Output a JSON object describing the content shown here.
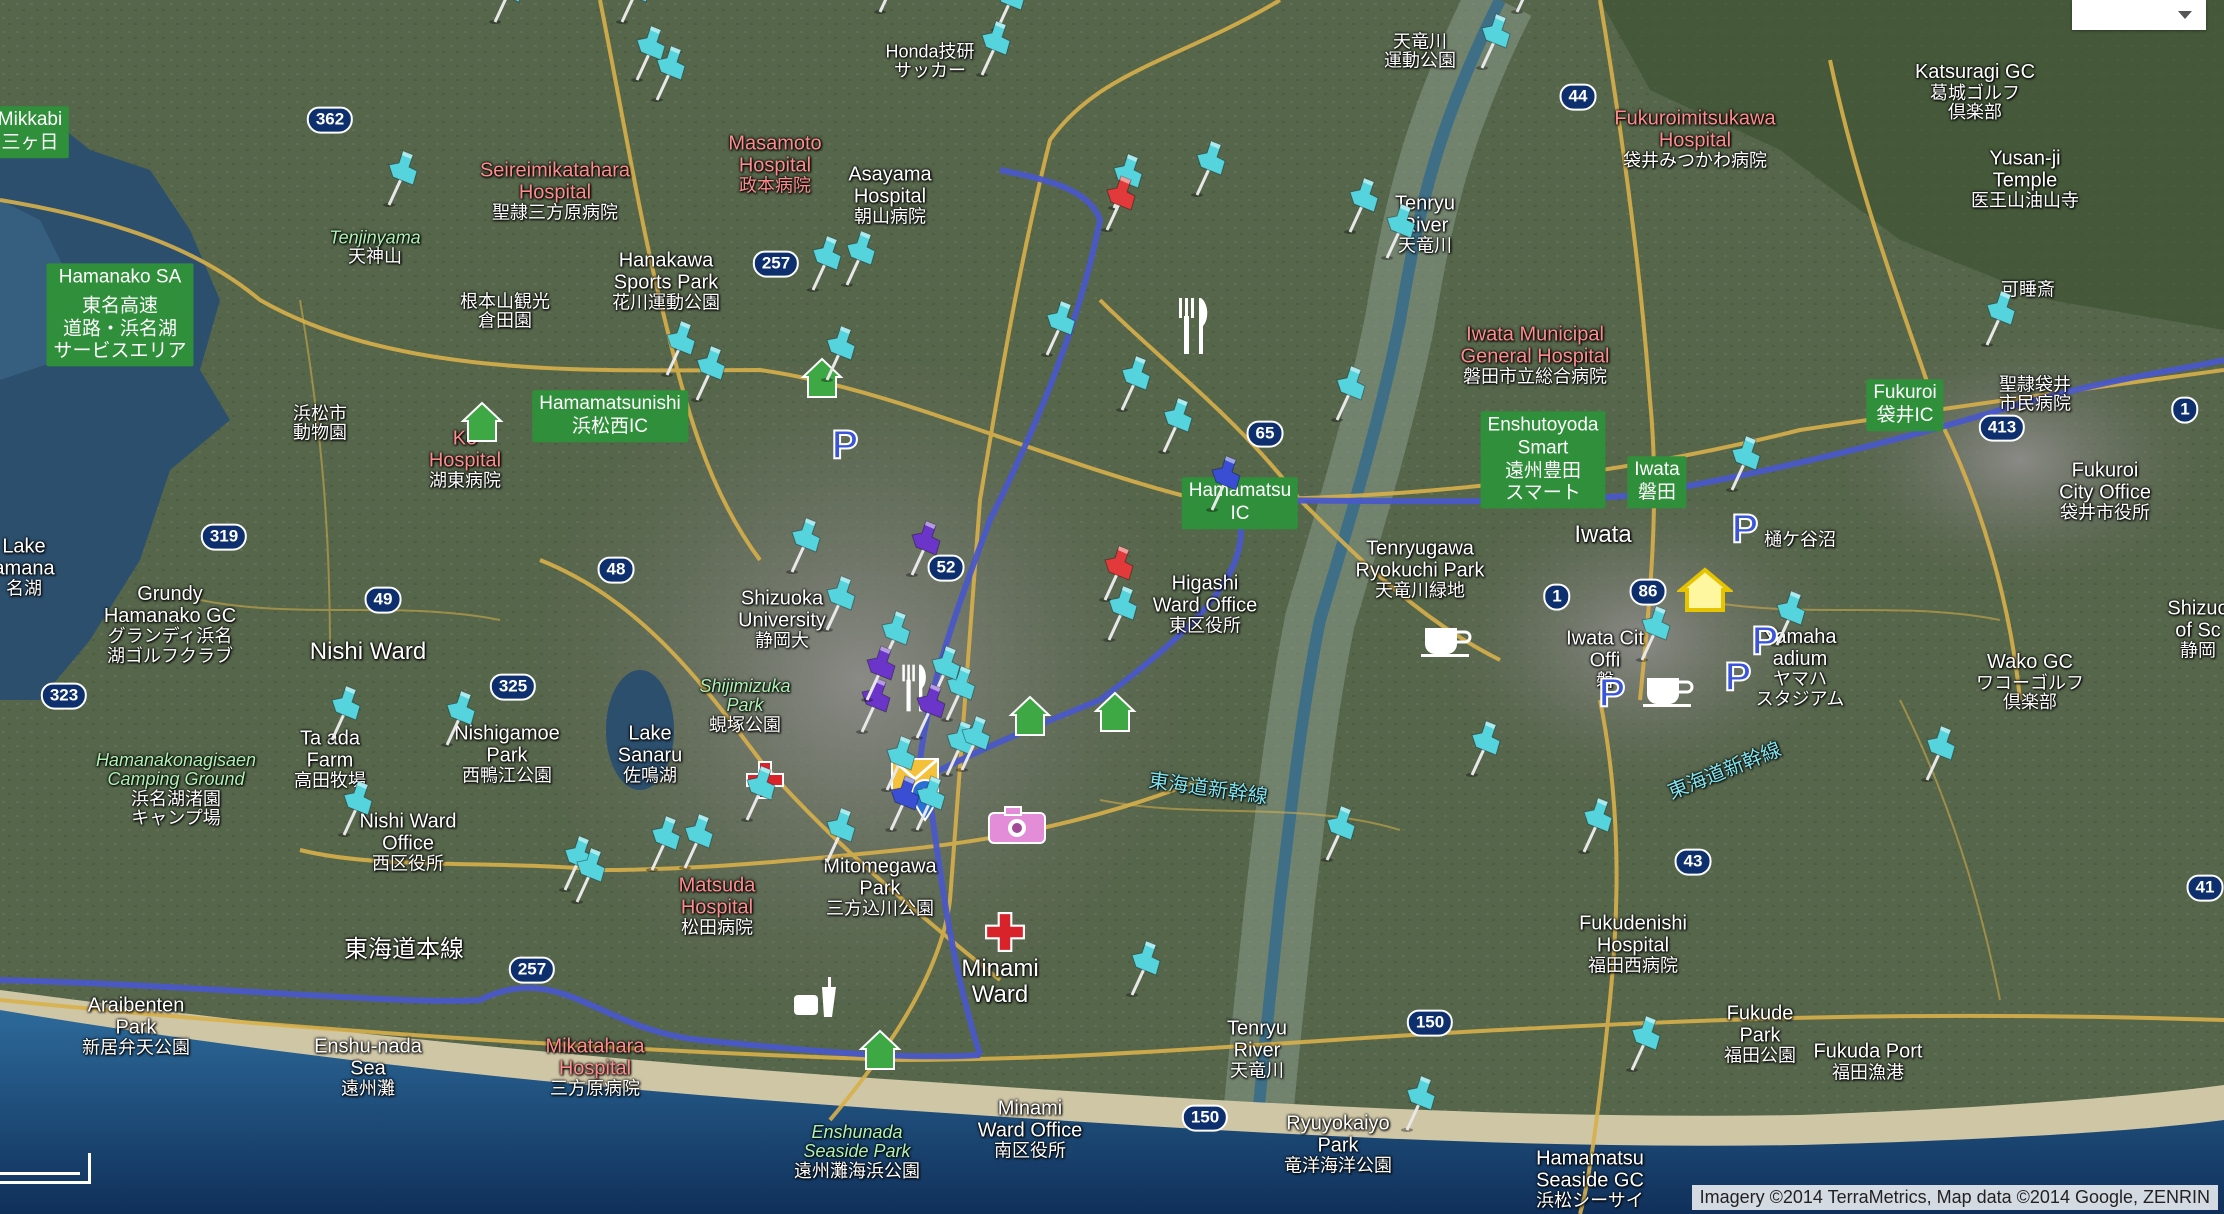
{
  "colors": {
    "highway": "#4a58c8",
    "road": "#d8b04a",
    "route_shield": "#0d2f6e",
    "hospital": "#ff8c8c",
    "park_text": "#aef2b4",
    "pin": "#56d4dd",
    "pin_red": "#e23a3a",
    "pin_purple": "#6a35c8",
    "pin_blue": "#3a4ed4",
    "label_box": "#2f8f3a",
    "sea": "#1f4e86"
  },
  "map_type_control": {
    "icon": "chevron-down-icon"
  },
  "attribution": "Imagery ©2014 TerraMetrics, Map data ©2014 Google, ZENRIN",
  "labels": {
    "tenryugawa": {
      "en": "",
      "jp": "天竜川"
    },
    "tenryugawa2": {
      "jp": "運動公園"
    },
    "honda": {
      "jp": "Honda技研"
    },
    "honda2": {
      "jp": "サッカー"
    },
    "katsuragi": {
      "en": "Katsuragi GC",
      "jp": "葛城ゴルフ"
    },
    "katsuragi2": {
      "jp": "倶楽部"
    },
    "mikkabi": {
      "en": "Mikkabi",
      "jp": "三ヶ日"
    },
    "masamoto": {
      "en": "Masamoto",
      "en2": "Hospital",
      "jp": "政本病院"
    },
    "asayama": {
      "en": "Asayama",
      "en2": "Hospital",
      "jp": "朝山病院"
    },
    "fukuroimitsukawa": {
      "en": "Fukuroimitsukawa",
      "en2": "Hospital",
      "jp": "袋井みつかわ病院"
    },
    "yusanji": {
      "en": "Yusan-ji",
      "en2": "Temple",
      "jp": "医王山油山寺"
    },
    "kashoin": {
      "jp": "可睡斎"
    },
    "seireimikatahara": {
      "en": "Seireimikatahara",
      "en2": "Hospital",
      "jp": "聖隷三方原病院"
    },
    "tenryuriver": {
      "en": "Tenryu",
      "en2": "River",
      "jp": "天竜川"
    },
    "tenjinyama": {
      "en": "Tenjinyama",
      "jp": "天神山"
    },
    "hanakawa": {
      "en": "Hanakawa",
      "en2": "Sports Park",
      "jp": "花川運動公園"
    },
    "nemotoyama": {
      "jp": "根本山観光",
      "jp2": "倉田園"
    },
    "hamanakosa": {
      "en": "Hamanako SA",
      "jp": "東名高速",
      "jp2": "道路・浜名湖",
      "jp3": "サービスエリア"
    },
    "iwatagen": {
      "en": "Iwata Municipal",
      "en2": "General Hospital",
      "jp": "磐田市立総合病院"
    },
    "hamamatsuzoo": {
      "jp": "浜松市",
      "jp2": "動物園"
    },
    "hamamatsunishi": {
      "en": "Hamamatsunishi",
      "jp": "浜松西IC"
    },
    "kohospital": {
      "en": "Ko",
      "en2": "Hospital",
      "jp": "湖東病院"
    },
    "fukuroi_ic": {
      "en": "Fukuroi",
      "jp": "袋井IC"
    },
    "seireifukuroi": {
      "jp": "聖隷袋井",
      "jp2": "市民病院"
    },
    "enshutoyoda": {
      "en": "Enshutoyoda",
      "en2": "Smart",
      "jp": "遠州豊田",
      "jp2": "スマート"
    },
    "iwata_ic": {
      "en": "Iwata",
      "jp": "磐田"
    },
    "hamamatsu_ic": {
      "en": "Hamamatsu",
      "jp": "IC"
    },
    "fukuroi_city": {
      "en": "Fukuroi",
      "en2": "City Office",
      "jp": "袋井市役所"
    },
    "hichigakubo": {
      "jp": "樋ケ谷沼"
    },
    "lakehamana": {
      "en": "Lake",
      "en2": "amana",
      "jp": "名湖"
    },
    "grundy": {
      "en": "Grundy",
      "en2": "Hamanako GC",
      "jp": "グランディ浜名",
      "jp2": "湖ゴルフクラブ"
    },
    "iwata": {
      "en": "Iwata"
    },
    "tenryugawa_park": {
      "en": "Tenryugawa",
      "en2": "Ryokuchi Park",
      "jp": "天竜川緑地"
    },
    "higashi": {
      "en": "Higashi",
      "en2": "Ward Office",
      "jp": "東区役所"
    },
    "shizuoka_univ": {
      "en": "Shizuoka",
      "en2": "University",
      "jp": "静岡大"
    },
    "nishi_ward": {
      "en": "Nishi Ward"
    },
    "iwata_city": {
      "en": "Iwata Cit",
      "en2": "Offi",
      "jp": "磐"
    },
    "yamaha": {
      "en": "Yamaha",
      "en2": "adium",
      "jp": "ヤマハ",
      "jp2": "スタジアム"
    },
    "wako": {
      "en": "Wako GC",
      "jp": "ワコーゴルフ",
      "jp2": "倶楽部"
    },
    "shizu": {
      "en": "Shizuo",
      "en2": "of Sc",
      "jp": "静岡"
    },
    "shijimizuka": {
      "en": "Shijimizuka",
      "en2": "Park",
      "jp": "蜆塚公園"
    },
    "tokaido_shinkansen": {
      "jp": "東海道新幹線"
    },
    "tokaido_shinkansen2": {
      "jp": "東海道新幹線"
    },
    "hamanako_camp": {
      "en": "Hamanakonagisaen",
      "en2": "Camping Ground",
      "jp": "浜名湖渚園",
      "jp2": "キャンプ場"
    },
    "takada": {
      "en": "Ta ada",
      "en2": "Farm",
      "jp": "高田牧場"
    },
    "nishigamoe": {
      "en": "Nishigamoe",
      "en2": "Park",
      "jp": "西鴨江公園"
    },
    "sanaru": {
      "en": "Lake",
      "en2": "Sanaru",
      "jp": "佐鳴湖"
    },
    "nishi_office": {
      "en": "Nishi Ward",
      "en2": "Office",
      "jp": "西区役所"
    },
    "tokaido_main": {
      "jp": "東海道本線"
    },
    "matsuda": {
      "en": "Matsuda",
      "en2": "Hospital",
      "jp": "松田病院"
    },
    "mitomegawa": {
      "en": "Mitomegawa",
      "en2": "Park",
      "jp": "三方込川公園"
    },
    "minami_ward": {
      "en": "Minami",
      "en2": "Ward"
    },
    "fukudenishi": {
      "en": "Fukudenishi",
      "en2": "Hospital",
      "jp": "福田西病院"
    },
    "araibenten": {
      "en": "Araibenten",
      "en2": "Park",
      "jp": "新居弁天公園"
    },
    "enshunada": {
      "en": "Enshu-nada",
      "en2": "Sea",
      "jp": "遠州灘"
    },
    "mikatahara2": {
      "en": "Mikatahara",
      "en2": "Hospital",
      "jp": "三方原病院"
    },
    "tenryu_river2": {
      "en": "Tenryu",
      "en2": "River",
      "jp": "天竜川"
    },
    "fukude_park": {
      "en": "Fukude",
      "en2": "Park",
      "jp": "福田公園"
    },
    "fukuda_port": {
      "en": "Fukuda Port",
      "jp": "福田漁港"
    },
    "minami_office": {
      "en": "Minami",
      "en2": "Ward Office",
      "jp": "南区役所"
    },
    "ryuyokaiyo": {
      "en": "Ryuyokaiyo",
      "en2": "Park",
      "jp": "竜洋海洋公園"
    },
    "enshunada_park": {
      "en": "Enshunada",
      "en2": "Seaside Park",
      "jp": "遠州灘海浜公園"
    },
    "hamamatsu_seaside": {
      "en": "Hamamatsu",
      "en2": "Seaside GC",
      "jp": "浜松シーサイ"
    }
  },
  "route_shields": [
    "362",
    "257",
    "44",
    "65",
    "319",
    "49",
    "48",
    "52",
    "1",
    "86",
    "413",
    "1",
    "323",
    "325",
    "43",
    "41",
    "257",
    "150",
    "150"
  ],
  "pins": {
    "cyan": 54,
    "red": 2,
    "purple": 4,
    "blue": 2
  },
  "icons": [
    "hospital-cross-icon",
    "hospital-cross-icon",
    "house-icon",
    "camera-icon",
    "envelope-icon",
    "parking-icon",
    "cafe-icon",
    "restaurant-icon",
    "drink-icon"
  ]
}
